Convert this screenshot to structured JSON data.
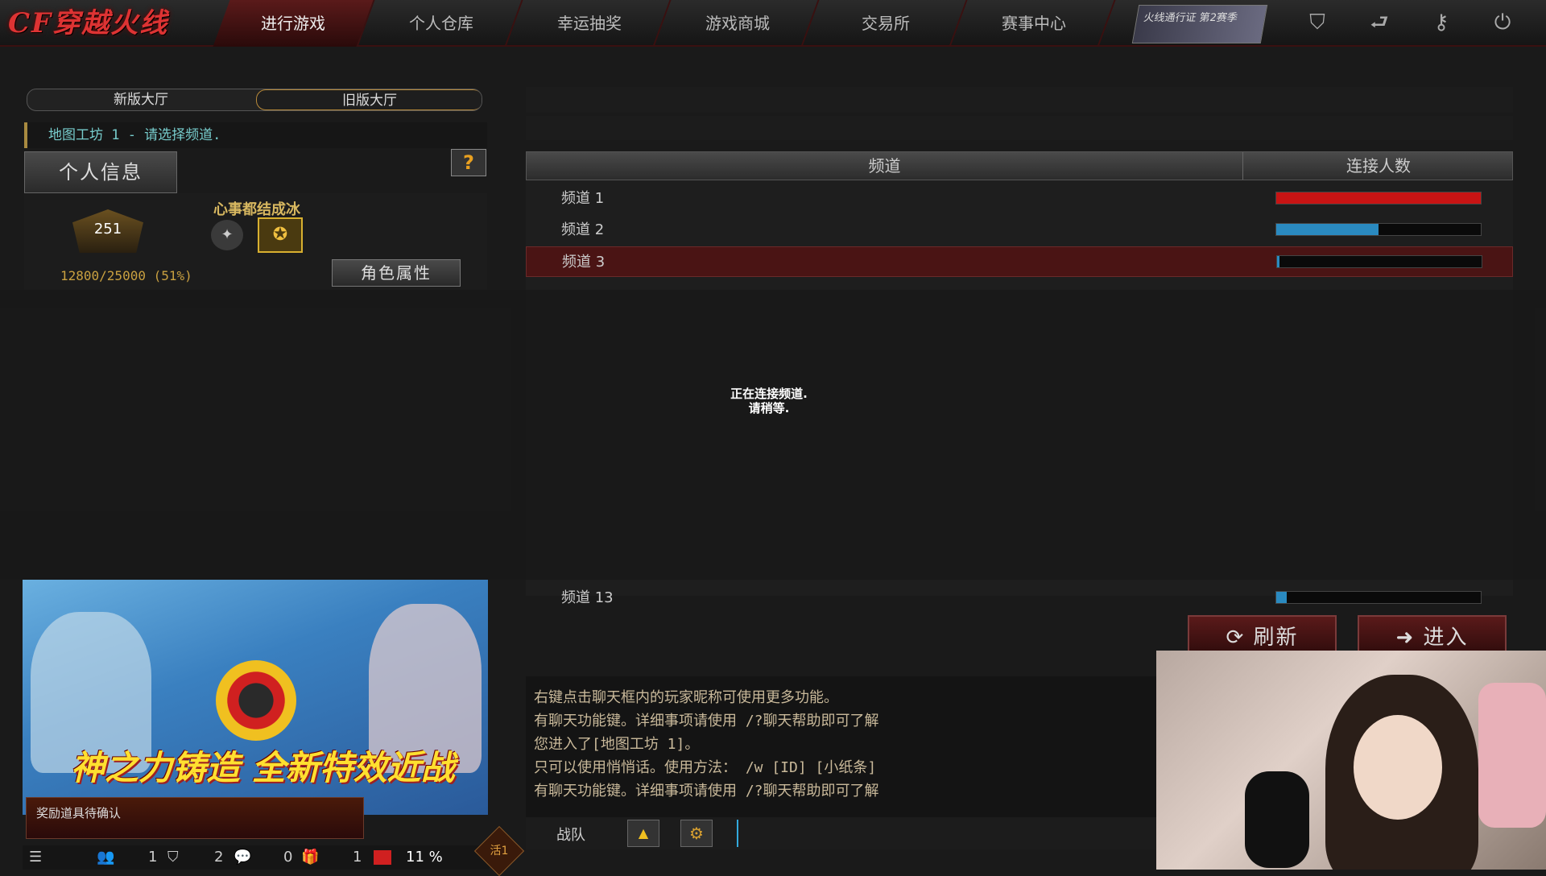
{
  "logo": "CF穿越火线",
  "nav": [
    {
      "label": "进行游戏",
      "active": true
    },
    {
      "label": "个人仓库"
    },
    {
      "label": "幸运抽奖"
    },
    {
      "label": "游戏商城"
    },
    {
      "label": "交易所"
    },
    {
      "label": "赛事中心"
    }
  ],
  "pass_badge": "火线通行证 第2赛季",
  "top_icons": [
    "shield-icon",
    "return-icon",
    "key-icon",
    "power-icon"
  ],
  "lobby_tabs": {
    "new": "新版大厅",
    "old": "旧版大厅"
  },
  "map_line": "地图工坊 1 - 请选择频道.",
  "profile": {
    "title": "个人信息",
    "help": "?",
    "rank": "251",
    "nickname": "心事都结成冰",
    "exp": "12800/25000 (51%)",
    "char_attr_button": "角色属性"
  },
  "table": {
    "headers": {
      "channel": "频道",
      "connections": "连接人数"
    },
    "rows": [
      {
        "name": "频道 1",
        "fill": 1.0,
        "color": "#c81414"
      },
      {
        "name": "频道 2",
        "fill": 0.5,
        "color": "#2a8ac0"
      },
      {
        "name": "频道 3",
        "fill": 0.01,
        "color": "#2a8ac0",
        "selected": true
      },
      {
        "name": "频道 13",
        "fill": 0.05,
        "color": "#2a8ac0"
      }
    ]
  },
  "loading": {
    "line1": "正在连接频道.",
    "line2": "请稍等."
  },
  "buttons": {
    "refresh": "⟳ 刷新",
    "enter": "➜ 进入"
  },
  "banner": {
    "title": "神之力铸造 全新特效近战"
  },
  "reward": "奖励道具待确认",
  "status": {
    "people": "1",
    "shield": "2",
    "chat": "0",
    "gift": "1",
    "percent": "11 %",
    "live": "活1"
  },
  "chat": {
    "lines": [
      "右键点击聊天框内的玩家昵称可使用更多功能。",
      "有聊天功能键。详细事项请使用 /?聊天帮助即可了解",
      "您进入了[地图工坊 1]。",
      "只可以使用悄悄话。使用方法： /w [ID] [小纸条]",
      "有聊天功能键。详细事项请使用 /?聊天帮助即可了解"
    ],
    "team_label": "战队"
  }
}
